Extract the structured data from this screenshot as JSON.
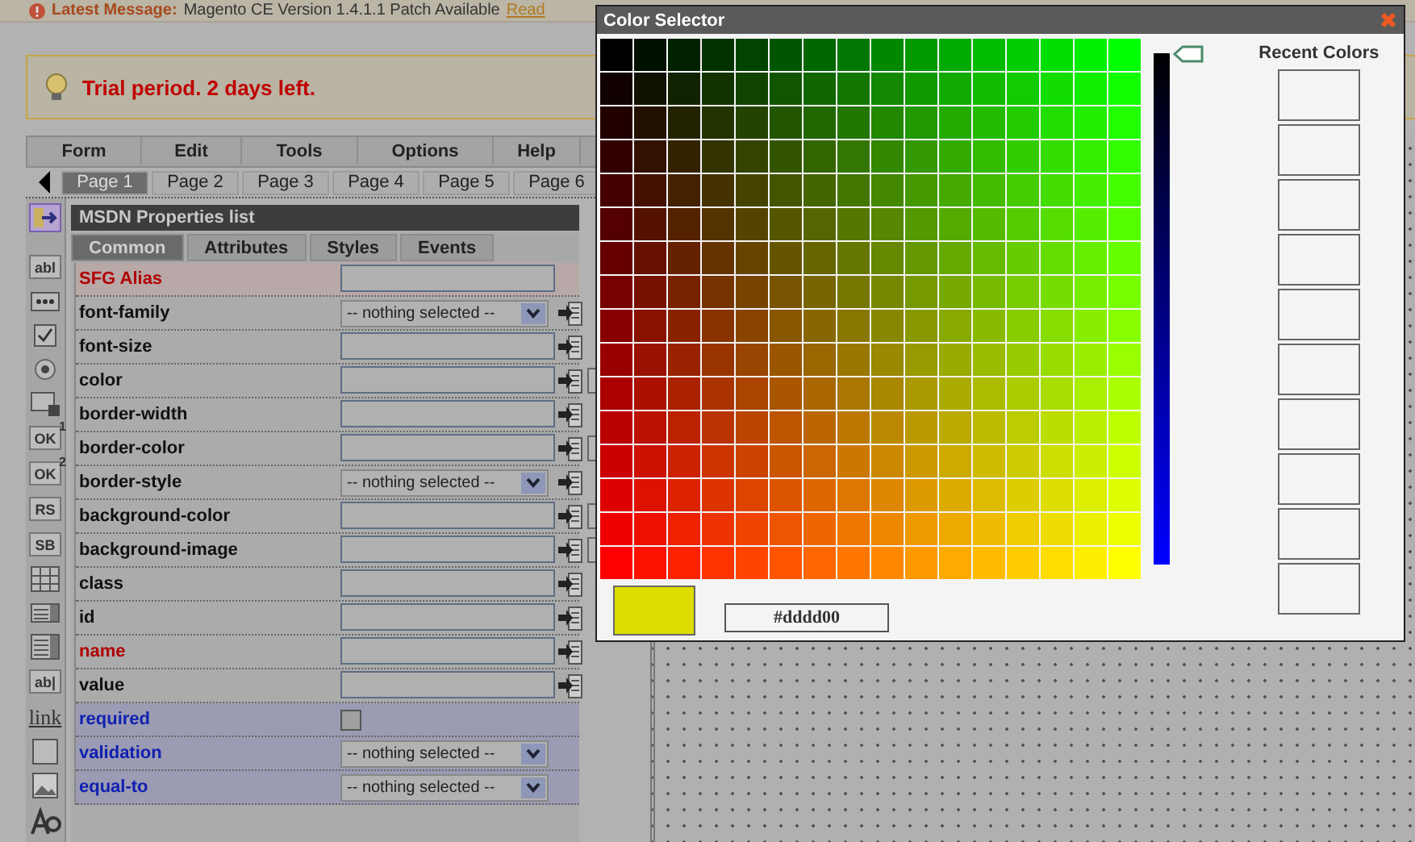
{
  "header": {
    "label": "Latest Message:",
    "message": "Magento CE Version 1.4.1.1 Patch Available",
    "link": "Read"
  },
  "notice": {
    "text": "Trial period. 2 days left."
  },
  "menu": [
    {
      "label": "Form"
    },
    {
      "label": "Edit"
    },
    {
      "label": "Tools"
    },
    {
      "label": "Options"
    },
    {
      "label": "Help"
    }
  ],
  "page_tabs": [
    {
      "label": "Page 1",
      "selected": true
    },
    {
      "label": "Page 2",
      "selected": false
    },
    {
      "label": "Page 3",
      "selected": false
    },
    {
      "label": "Page 4",
      "selected": false
    },
    {
      "label": "Page 5",
      "selected": false
    },
    {
      "label": "Page 6",
      "selected": false
    }
  ],
  "tools": [
    {
      "kind": "insert"
    },
    {
      "kind": "text",
      "label": "abl"
    },
    {
      "kind": "password"
    },
    {
      "kind": "checkbox"
    },
    {
      "kind": "radio"
    },
    {
      "kind": "file"
    },
    {
      "kind": "text",
      "label": "OK",
      "sup": "1"
    },
    {
      "kind": "text",
      "label": "OK",
      "sup": "2"
    },
    {
      "kind": "text",
      "label": "RS"
    },
    {
      "kind": "text",
      "label": "SB"
    },
    {
      "kind": "grid"
    },
    {
      "kind": "list"
    },
    {
      "kind": "listbox"
    },
    {
      "kind": "text",
      "label": "ab|"
    },
    {
      "kind": "link",
      "label": "link"
    },
    {
      "kind": "square"
    },
    {
      "kind": "image"
    },
    {
      "kind": "font"
    }
  ],
  "properties": {
    "title": "MSDN Properties list",
    "tabs": [
      {
        "label": "Common",
        "selected": true
      },
      {
        "label": "Attributes",
        "selected": false
      },
      {
        "label": "Styles",
        "selected": false
      },
      {
        "label": "Events",
        "selected": false
      }
    ],
    "rows": [
      {
        "name": "SFG Alias",
        "kind": "alias",
        "field": {
          "kind": "text"
        },
        "action": false,
        "side_button": false
      },
      {
        "name": "font-family",
        "kind": "normal",
        "field": {
          "kind": "select",
          "value": "-- nothing selected --"
        },
        "action": true,
        "side_button": false
      },
      {
        "name": "font-size",
        "kind": "normal",
        "field": {
          "kind": "text"
        },
        "action": true,
        "side_button": false
      },
      {
        "name": "color",
        "kind": "normal",
        "field": {
          "kind": "text"
        },
        "action": true,
        "side_button": true
      },
      {
        "name": "border-width",
        "kind": "normal",
        "field": {
          "kind": "text"
        },
        "action": true,
        "side_button": false
      },
      {
        "name": "border-color",
        "kind": "normal",
        "field": {
          "kind": "text"
        },
        "action": true,
        "side_button": true
      },
      {
        "name": "border-style",
        "kind": "normal",
        "field": {
          "kind": "select",
          "value": "-- nothing selected --"
        },
        "action": true,
        "side_button": false
      },
      {
        "name": "background-color",
        "kind": "normal",
        "field": {
          "kind": "text"
        },
        "action": true,
        "side_button": true
      },
      {
        "name": "background-image",
        "kind": "normal",
        "field": {
          "kind": "text"
        },
        "action": true,
        "side_button": true
      },
      {
        "name": "class",
        "kind": "normal",
        "field": {
          "kind": "text"
        },
        "action": true,
        "side_button": false
      },
      {
        "name": "id",
        "kind": "normal",
        "field": {
          "kind": "text"
        },
        "action": true,
        "side_button": false
      },
      {
        "name": "name",
        "kind": "required",
        "field": {
          "kind": "text"
        },
        "action": true,
        "side_button": false
      },
      {
        "name": "value",
        "kind": "normal",
        "field": {
          "kind": "text"
        },
        "action": true,
        "side_button": false
      },
      {
        "name": "required",
        "kind": "validation",
        "field": {
          "kind": "checkbox",
          "checked": false
        },
        "action": false,
        "side_button": false
      },
      {
        "name": "validation",
        "kind": "validation",
        "field": {
          "kind": "select",
          "value": "-- nothing selected --"
        },
        "action": false,
        "side_button": false
      },
      {
        "name": "equal-to",
        "kind": "validation",
        "field": {
          "kind": "select",
          "value": "-- nothing selected --"
        },
        "action": false,
        "side_button": false
      }
    ]
  },
  "color_selector": {
    "title": "Color Selector",
    "recent_title": "Recent Colors",
    "hex": "#dddd00",
    "brightness": {
      "level": 0
    }
  }
}
